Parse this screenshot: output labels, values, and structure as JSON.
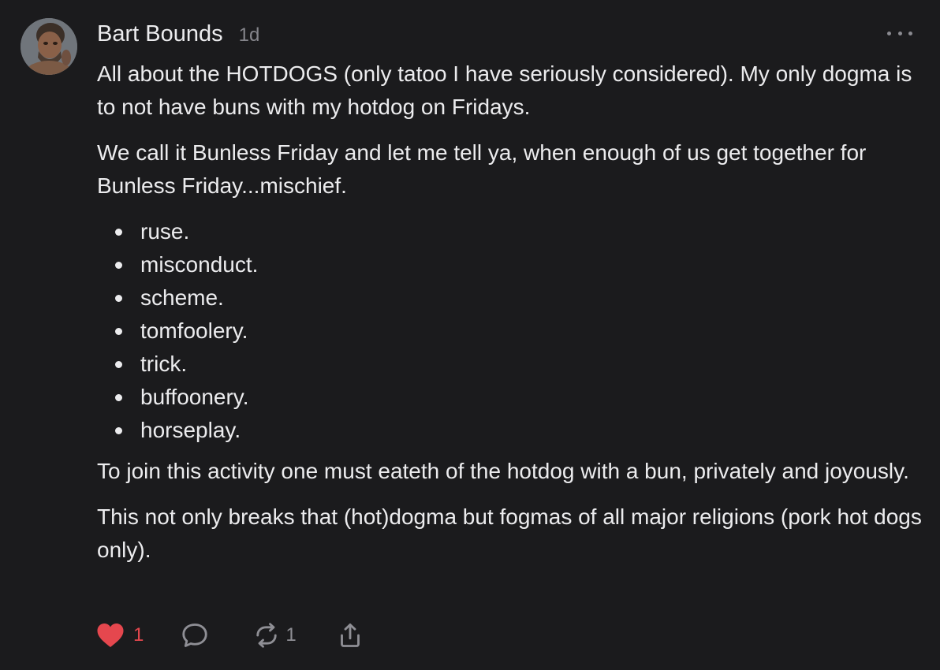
{
  "post": {
    "author": "Bart Bounds",
    "time": "1d",
    "paragraph_1": "All about the HOTDOGS (only tatoo I have seriously considered). My only dogma is to not have buns with my hotdog on Fridays.",
    "paragraph_2": "We call it Bunless Friday and let me tell ya, when enough of us get together for Bunless Friday...mischief.",
    "list": [
      "ruse.",
      "misconduct.",
      "scheme.",
      "tomfoolery.",
      "trick.",
      "buffoonery.",
      "horseplay."
    ],
    "paragraph_3": "To join this activity one must eateth of the hotdog with a bun, privately and joyously.",
    "paragraph_4": "This not only breaks that (hot)dogma but fogmas of all major religions (pork hot dogs only)."
  },
  "actions": {
    "like_count": "1",
    "repost_count": "1",
    "like_icon": "heart-filled-icon",
    "reply_icon": "speech-bubble-icon",
    "repost_icon": "repost-arrows-icon",
    "share_icon": "share-upload-icon"
  },
  "colors": {
    "background": "#1b1b1d",
    "text": "#ececee",
    "muted": "#85858b",
    "like": "#e5474e"
  }
}
